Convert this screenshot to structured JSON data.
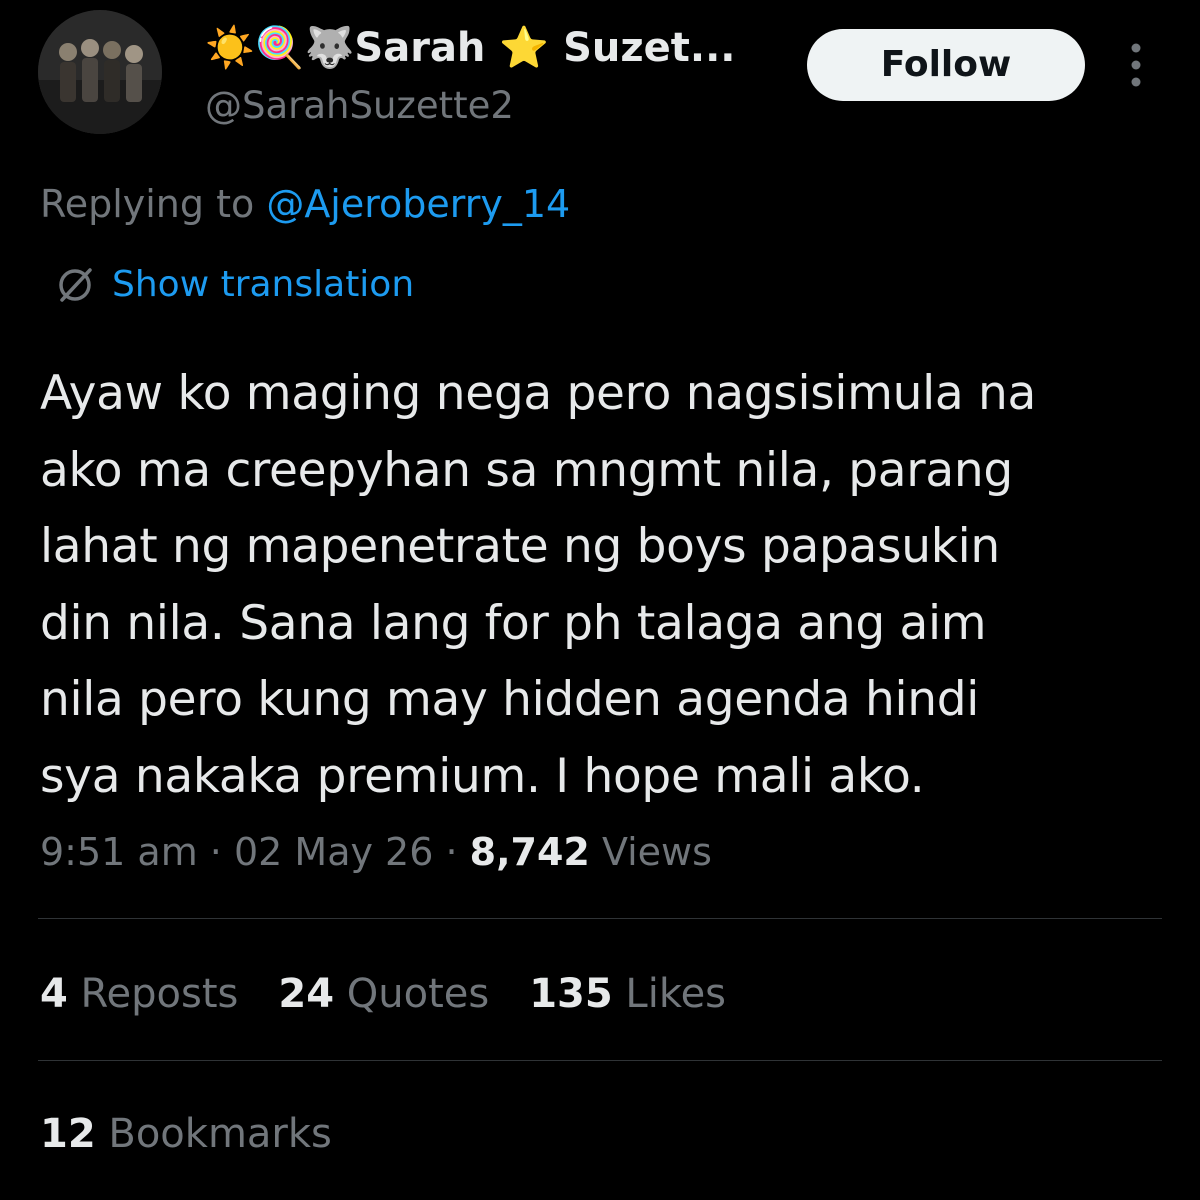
{
  "author": {
    "display_name": "☀️🍭🐺Sarah ⭐ Suzet...",
    "handle": "@SarahSuzette2"
  },
  "follow_button": {
    "label": "Follow"
  },
  "reply": {
    "prefix": "Replying to ",
    "mention": "@Ajeroberry_14"
  },
  "translation": {
    "label": "Show translation"
  },
  "tweet": {
    "lines": [
      "Ayaw ko maging nega pero nagsisimula na",
      "ako ma creepyhan sa mngmt nila, parang",
      "lahat ng mapenetrate ng boys papasukin",
      "din nila. Sana lang for ph talaga ang aim",
      "nila pero kung may hidden agenda hindi",
      "sya nakaka premium. I hope mali ako."
    ]
  },
  "meta": {
    "time": "9:51 am",
    "separator": " · ",
    "date": "02 May 26",
    "views_count": "8,742",
    "views_label": " Views"
  },
  "stats": {
    "reposts_count": "4",
    "reposts_label": " Reposts",
    "quotes_count": "24",
    "quotes_label": " Quotes",
    "likes_count": "135",
    "likes_label": " Likes",
    "bookmarks_count": "12",
    "bookmarks_label": " Bookmarks"
  },
  "colors": {
    "background": "#000000",
    "text_primary": "#e7e9ea",
    "text_secondary": "#71767b",
    "link": "#1d9bf0",
    "divider": "#2f3336",
    "follow_bg": "#eff3f4"
  },
  "icons": {
    "more": "more-vertical-icon",
    "translate": "globe-slash-icon"
  }
}
